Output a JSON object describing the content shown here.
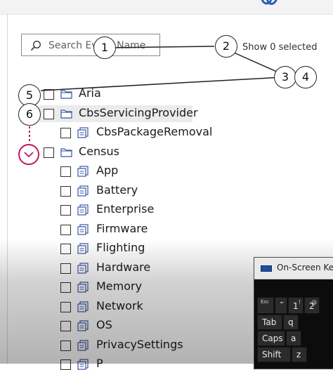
{
  "search": {
    "placeholder": "Search Event Name"
  },
  "selection_summary": "Show 0 selected",
  "tree": [
    {
      "label": "Aria",
      "type": "folder",
      "level": 0
    },
    {
      "label": "CbsServicingProvider",
      "type": "folder",
      "level": 0,
      "highlighted": true
    },
    {
      "label": "CbsPackageRemoval",
      "type": "provider",
      "level": 1
    },
    {
      "label": "Census",
      "type": "folder",
      "level": 0,
      "expanded": true
    },
    {
      "label": "App",
      "type": "provider",
      "level": 1
    },
    {
      "label": "Battery",
      "type": "provider",
      "level": 1
    },
    {
      "label": "Enterprise",
      "type": "provider",
      "level": 1
    },
    {
      "label": "Firmware",
      "type": "provider",
      "level": 1
    },
    {
      "label": "Flighting",
      "type": "provider",
      "level": 1
    },
    {
      "label": "Hardware",
      "type": "provider",
      "level": 1
    },
    {
      "label": "Memory",
      "type": "provider",
      "level": 1
    },
    {
      "label": "Network",
      "type": "provider",
      "level": 1
    },
    {
      "label": "OS",
      "type": "provider",
      "level": 1
    },
    {
      "label": "PrivacySettings",
      "type": "provider",
      "level": 1
    },
    {
      "label": "P",
      "type": "provider",
      "level": 1
    }
  ],
  "callouts": [
    "1",
    "2",
    "3",
    "4",
    "5",
    "6"
  ],
  "osk": {
    "title": "On-Screen Key",
    "keys": {
      "esc": "Esc",
      "tilde_top": "~",
      "tilde": "`",
      "one_top": "!",
      "one": "1",
      "two_top": "@",
      "two": "2",
      "tab": "Tab",
      "q": "q",
      "caps": "Caps",
      "a": "a",
      "shift": "Shift",
      "z": "z"
    }
  },
  "colors": {
    "accent_callout": "#c0175d",
    "icon_blue": "#3a56a5",
    "highlight_row": "#ebebeb"
  },
  "icons": {
    "search": "search-icon",
    "folder": "folder-icon",
    "provider": "provider-icon",
    "expand": "chevron-down-icon",
    "keyboard": "keyboard-icon"
  }
}
